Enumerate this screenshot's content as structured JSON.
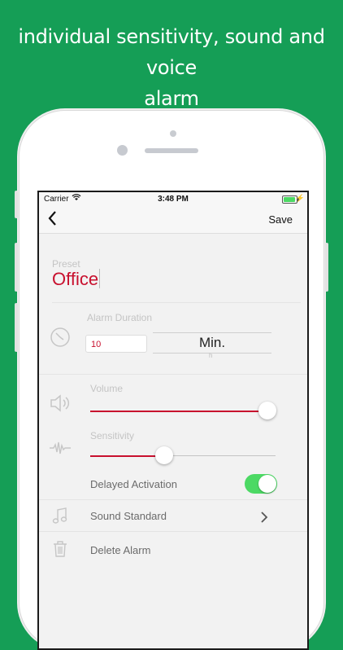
{
  "headline": {
    "line1": "individual sensitivity, sound and voice",
    "line2": "alarm"
  },
  "status_bar": {
    "carrier": "Carrier",
    "time": "3:48 PM"
  },
  "nav": {
    "save_label": "Save"
  },
  "preset": {
    "label": "Preset",
    "value": "Office"
  },
  "alarm_duration": {
    "label": "Alarm Duration",
    "value": "10",
    "unit": "Min.",
    "next_unit_hint": "h"
  },
  "volume": {
    "label": "Volume",
    "level": 1.0
  },
  "sensitivity": {
    "label": "Sensitivity",
    "level": 0.4
  },
  "delayed_activation": {
    "label": "Delayed Activation",
    "enabled": true
  },
  "sound": {
    "label": "Sound Standard"
  },
  "delete": {
    "label": "Delete Alarm"
  },
  "colors": {
    "background": "#159e56",
    "accent_red": "#c8102e",
    "toggle_on": "#4cd964"
  },
  "icons": [
    "wifi-icon",
    "battery-icon",
    "back-chevron-icon",
    "clock-icon",
    "speaker-icon",
    "waveform-icon",
    "music-note-icon",
    "trash-icon",
    "chevron-right-icon"
  ]
}
